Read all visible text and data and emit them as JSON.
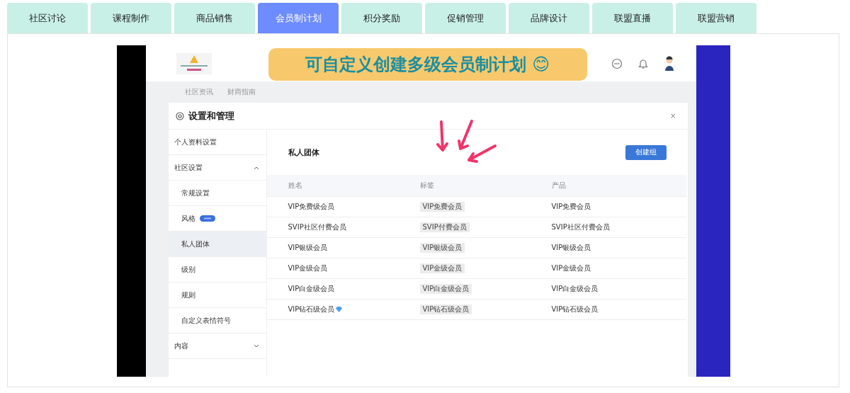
{
  "tabs": [
    {
      "label": "社区讨论",
      "selected": false
    },
    {
      "label": "课程制作",
      "selected": false
    },
    {
      "label": "商品销售",
      "selected": false
    },
    {
      "label": "会员制计划",
      "selected": true
    },
    {
      "label": "积分奖励",
      "selected": false
    },
    {
      "label": "促销管理",
      "selected": false
    },
    {
      "label": "品牌设计",
      "selected": false
    },
    {
      "label": "联盟直播",
      "selected": false
    },
    {
      "label": "联盟营销",
      "selected": false
    }
  ],
  "demo": {
    "caption": "可自定义创建多级会员制计划 😊",
    "nav": [
      "社区资讯",
      "财商指南"
    ],
    "modal": {
      "title": "设置和管理",
      "close": "×",
      "sidebar": [
        {
          "label": "个人资料设置",
          "kind": "item",
          "selected": false
        },
        {
          "label": "社区设置",
          "kind": "group",
          "expanded": true,
          "children": [
            {
              "label": "常规设置",
              "kind": "item",
              "selected": false
            },
            {
              "label": "风格",
              "kind": "item",
              "selected": false,
              "badge": true
            },
            {
              "label": "私人团体",
              "kind": "item",
              "selected": true
            },
            {
              "label": "级别",
              "kind": "item",
              "selected": false
            },
            {
              "label": "规则",
              "kind": "item",
              "selected": false
            },
            {
              "label": "自定义表情符号",
              "kind": "item",
              "selected": false
            }
          ]
        },
        {
          "label": "内容",
          "kind": "group",
          "expanded": false
        }
      ],
      "section_title": "私人团体",
      "create_button": "创建组",
      "columns": [
        "姓名",
        "标签",
        "产品"
      ],
      "rows": [
        {
          "name": "VIP免费级会员",
          "tag": "VIP免费会员",
          "product": "VIP免费会员",
          "gem": false
        },
        {
          "name": "SVIP社区付费会员",
          "tag": "SVIP付费会员",
          "product": "SVIP社区付费会员",
          "gem": false
        },
        {
          "name": "VIP银级会员",
          "tag": "VIP银级会员",
          "product": "VIP银级会员",
          "gem": false
        },
        {
          "name": "VIP金级会员",
          "tag": "VIP金级会员",
          "product": "VIP金级会员",
          "gem": false
        },
        {
          "name": "VIP白金级会员",
          "tag": "VIP白金级会员",
          "product": "VIP白金级会员",
          "gem": false
        },
        {
          "name": "VIP钻石级会员",
          "tag": "VIP钻石级会员",
          "product": "VIP钻石级会员",
          "gem": true
        }
      ]
    }
  }
}
